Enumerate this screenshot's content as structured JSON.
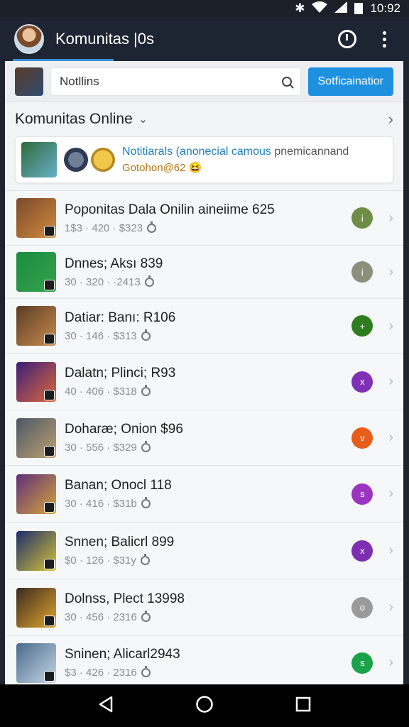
{
  "status_bar": {
    "time": "10:92"
  },
  "app_bar": {
    "title": "Komunitas |0s",
    "avatar_icon": "user-avatar",
    "power_icon": "power-icon",
    "menu_icon": "more-vert-icon"
  },
  "search": {
    "value": "Notllins",
    "button_label": "Sotficainatior"
  },
  "section": {
    "title": "Komunitas Online"
  },
  "notice": {
    "line1_highlight": "Notitiarals",
    "line1_rest": " (anonecial camous",
    "line1_tail": " pnemicannand",
    "line2": "Gotohon@62 😆"
  },
  "rows": [
    {
      "title": "Poponitas Dala Onilin aineiime 625",
      "meta": "1$3 · 420 · $323",
      "dot_color": "#6e8d46",
      "dot_glyph": "i",
      "thumb_a": "#7b4a2d",
      "thumb_b": "#d08a3c"
    },
    {
      "title": "Dnnes; Aksı 839",
      "meta": "30 · 320 · ·2413",
      "dot_color": "#8c8f7c",
      "dot_glyph": "i",
      "thumb_a": "#1a8c3d",
      "thumb_b": "#35a34f"
    },
    {
      "title": "Datiar: Banı: R106",
      "meta": "30 · 146 · $313",
      "dot_color": "#2e7d1f",
      "dot_glyph": "+",
      "thumb_a": "#5a3c24",
      "thumb_b": "#c98b4e"
    },
    {
      "title": "Dalatn; Plinci; R93",
      "meta": "40 · 406 · $318",
      "dot_color": "#8030b5",
      "dot_glyph": "x",
      "thumb_a": "#3a1f7a",
      "thumb_b": "#e0673a"
    },
    {
      "title": "Doharæ; Onion $96",
      "meta": "30 · 556 · $329",
      "dot_color": "#e85d1a",
      "dot_glyph": "v",
      "thumb_a": "#4a5868",
      "thumb_b": "#c0a070"
    },
    {
      "title": "Banan; Onocl 118",
      "meta": "30 · 416 · $31b",
      "dot_color": "#9a35c2",
      "dot_glyph": "s",
      "thumb_a": "#5e2f7a",
      "thumb_b": "#d8a53a"
    },
    {
      "title": "Snnen; Balicrl 899",
      "meta": "$0 · 126 · $31y",
      "dot_color": "#7c2fb0",
      "dot_glyph": "x",
      "thumb_a": "#1b2d6b",
      "thumb_b": "#d8c23a"
    },
    {
      "title": "Dolnss, Plect 13998",
      "meta": "30 · 456 · 2316",
      "dot_color": "#9a9a9a",
      "dot_glyph": "o",
      "thumb_a": "#3a2a22",
      "thumb_b": "#e0a52a"
    },
    {
      "title": "Sninen; Alicarl2943",
      "meta": "$3 · 426 · 2316",
      "dot_color": "#1aa34a",
      "dot_glyph": "s",
      "thumb_a": "#4a6a8a",
      "thumb_b": "#c6d6e8"
    }
  ],
  "nav": {
    "back_icon": "back-triangle-icon",
    "home_icon": "home-circle-icon",
    "recents_icon": "recents-square-icon"
  }
}
